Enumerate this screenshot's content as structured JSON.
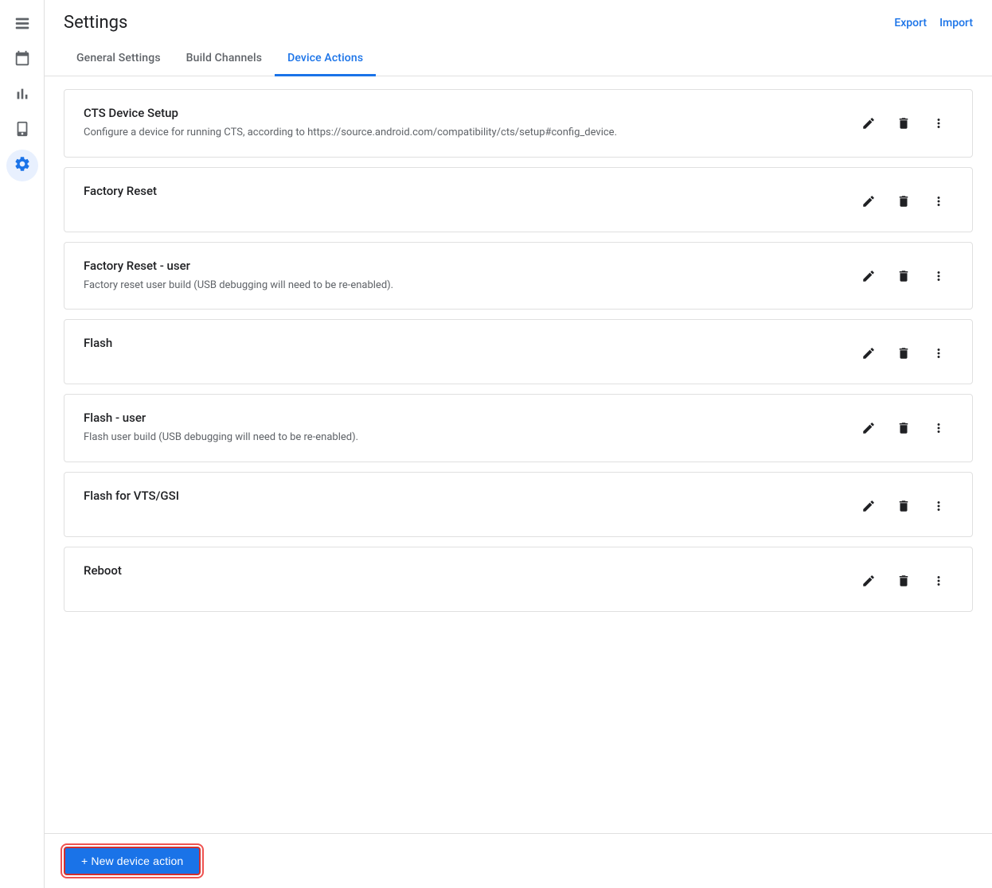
{
  "header": {
    "title": "Settings",
    "export_label": "Export",
    "import_label": "Import"
  },
  "tabs": [
    {
      "id": "general",
      "label": "General Settings",
      "active": false
    },
    {
      "id": "build-channels",
      "label": "Build Channels",
      "active": false
    },
    {
      "id": "device-actions",
      "label": "Device Actions",
      "active": true
    }
  ],
  "sidebar": {
    "items": [
      {
        "id": "list",
        "icon": "list-icon",
        "active": false
      },
      {
        "id": "calendar",
        "icon": "calendar-icon",
        "active": false
      },
      {
        "id": "bar-chart",
        "icon": "bar-chart-icon",
        "active": false
      },
      {
        "id": "phone",
        "icon": "phone-icon",
        "active": false
      },
      {
        "id": "gear",
        "icon": "gear-icon",
        "active": true
      }
    ]
  },
  "device_actions": [
    {
      "id": "cts-device-setup",
      "title": "CTS Device Setup",
      "description": "Configure a device for running CTS, according to https://source.android.com/compatibility/cts/setup#config_device."
    },
    {
      "id": "factory-reset",
      "title": "Factory Reset",
      "description": ""
    },
    {
      "id": "factory-reset-user",
      "title": "Factory Reset - user",
      "description": "Factory reset user build (USB debugging will need to be re-enabled)."
    },
    {
      "id": "flash",
      "title": "Flash",
      "description": ""
    },
    {
      "id": "flash-user",
      "title": "Flash - user",
      "description": "Flash user build (USB debugging will need to be re-enabled)."
    },
    {
      "id": "flash-vts-gsi",
      "title": "Flash for VTS/GSI",
      "description": ""
    },
    {
      "id": "reboot",
      "title": "Reboot",
      "description": ""
    }
  ],
  "bottom": {
    "new_action_label": "+ New device action"
  }
}
